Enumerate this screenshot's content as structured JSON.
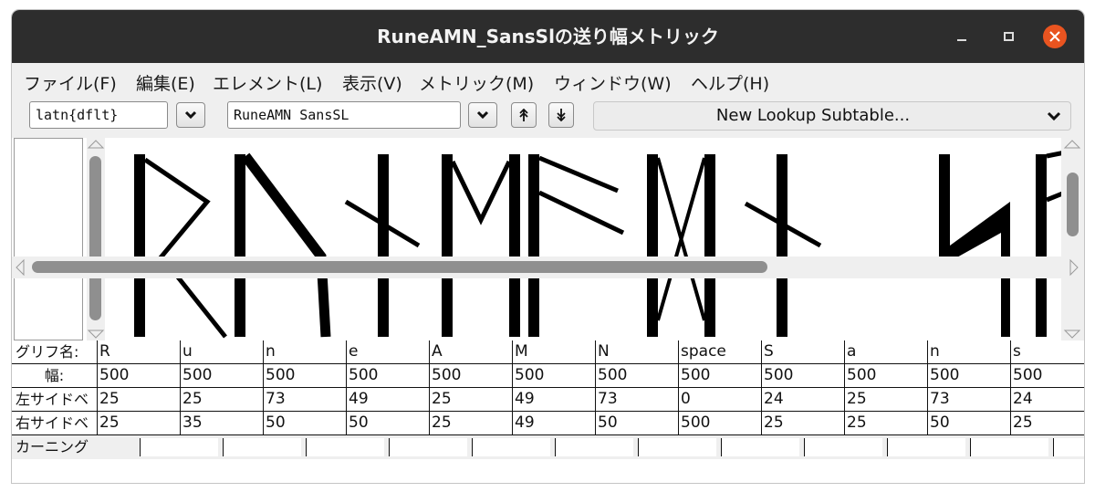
{
  "window": {
    "title": "RuneAMN_SansSlの送り幅メトリック"
  },
  "menu": [
    {
      "label": "ファイル(F)"
    },
    {
      "label": "編集(E)"
    },
    {
      "label": "エレメント(L)"
    },
    {
      "label": "表示(V)"
    },
    {
      "label": "メトリック(M)"
    },
    {
      "label": "ウィンドウ(W)"
    },
    {
      "label": "ヘルプ(H)"
    }
  ],
  "toolbar": {
    "script_lang": "latn{dflt}",
    "text_field": "RuneAMN SansSL",
    "lookup_subtable": "New Lookup Subtable..."
  },
  "metrics": {
    "row_labels": {
      "glyph_name": "グリフ名:",
      "width": "幅:",
      "lsb": "左サイドベ",
      "rsb": "右サイドベ",
      "kerning": "カーニング"
    },
    "glyphs": [
      {
        "name": "R",
        "width": "500",
        "lsb": "25",
        "rsb": "25"
      },
      {
        "name": "u",
        "width": "500",
        "lsb": "25",
        "rsb": "35"
      },
      {
        "name": "n",
        "width": "500",
        "lsb": "73",
        "rsb": "50"
      },
      {
        "name": "e",
        "width": "500",
        "lsb": "49",
        "rsb": "50"
      },
      {
        "name": "A",
        "width": "500",
        "lsb": "25",
        "rsb": "25"
      },
      {
        "name": "M",
        "width": "500",
        "lsb": "49",
        "rsb": "49"
      },
      {
        "name": "N",
        "width": "500",
        "lsb": "73",
        "rsb": "50"
      },
      {
        "name": "space",
        "width": "500",
        "lsb": "0",
        "rsb": "500"
      },
      {
        "name": "S",
        "width": "500",
        "lsb": "24",
        "rsb": "25"
      },
      {
        "name": "a",
        "width": "500",
        "lsb": "25",
        "rsb": "25"
      },
      {
        "name": "n",
        "width": "500",
        "lsb": "73",
        "rsb": "50"
      },
      {
        "name": "s",
        "width": "500",
        "lsb": "24",
        "rsb": "25"
      }
    ]
  },
  "colors": {
    "titlebar": "#2d2d2d",
    "close_button": "#e95420",
    "glyph_ink": "#000000"
  }
}
